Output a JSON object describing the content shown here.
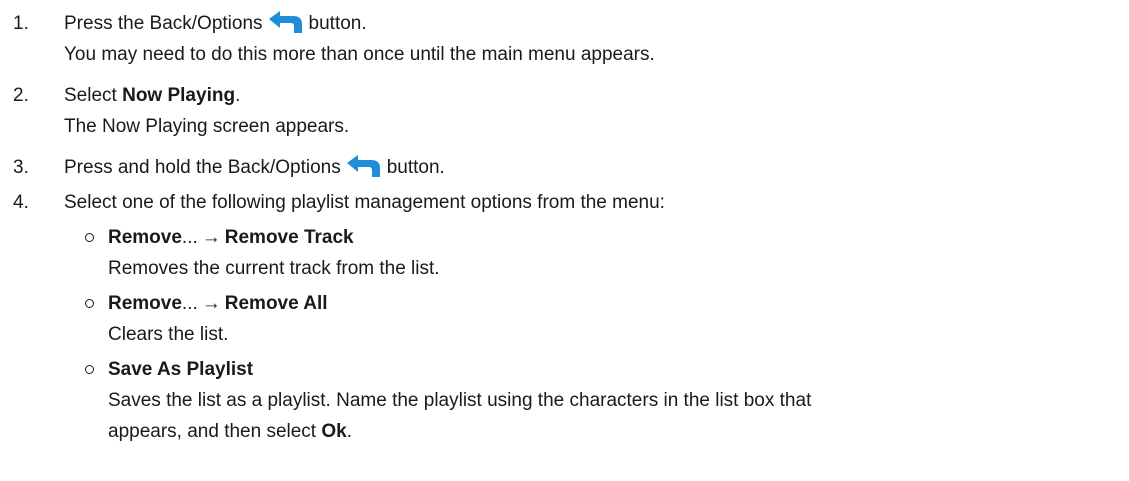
{
  "steps": [
    {
      "number": "1.",
      "line1_before": "Press the Back/Options",
      "icon": "back-arrow-icon",
      "line1_after": "button.",
      "line2": "You may need to do this more than once until the main menu appears."
    },
    {
      "number": "2.",
      "line1_before": "Select",
      "line1_bold": "Now Playing",
      "line1_after": ".",
      "line2": "The Now Playing screen appears."
    },
    {
      "number": "3.",
      "line1_before": "Press and hold the Back/Options",
      "icon": "back-arrow-icon",
      "line1_after": "button."
    },
    {
      "number": "4.",
      "line1": "Select one of the following playlist management options from the menu:",
      "options": [
        {
          "bold1": "Remove",
          "ellipsis": "...",
          "arrow": "→",
          "bold2": "Remove Track",
          "desc": "Removes the current track from the list."
        },
        {
          "bold1": "Remove",
          "ellipsis": "...",
          "arrow": "→",
          "bold2": "Remove All",
          "desc": "Clears the list."
        },
        {
          "bold1": "Save As Playlist",
          "desc_line1": "Saves the list as a playlist. Name the playlist using the characters in the list box that",
          "desc_line2_before": "appears, and then select",
          "desc_line2_bold": "Ok",
          "desc_line2_after": "."
        }
      ]
    }
  ],
  "colors": {
    "icon_blue": "#1e8fd6",
    "text": "#1a1a1a"
  }
}
